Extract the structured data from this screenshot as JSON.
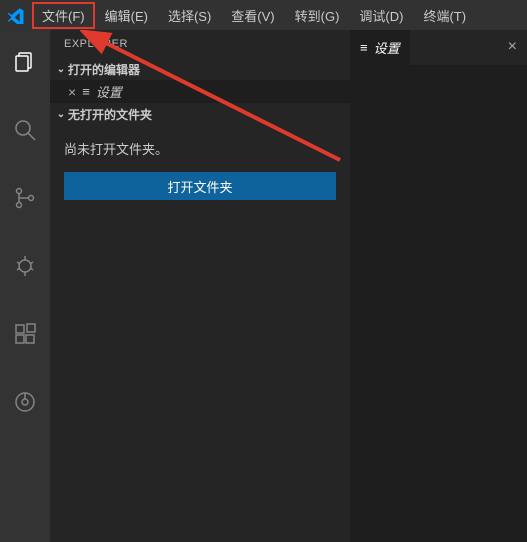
{
  "menu": {
    "file": "文件(F)",
    "edit": "编辑(E)",
    "select": "选择(S)",
    "view": "查看(V)",
    "goto": "转到(G)",
    "debug": "调试(D)",
    "terminal": "终端(T)"
  },
  "sidebar": {
    "header": "EXPLORER",
    "openEditors": {
      "title": "打开的编辑器",
      "item": "设置"
    },
    "noFolder": {
      "title": "无打开的文件夹",
      "message": "尚未打开文件夹。",
      "button": "打开文件夹"
    }
  },
  "editor": {
    "tab": "设置"
  }
}
